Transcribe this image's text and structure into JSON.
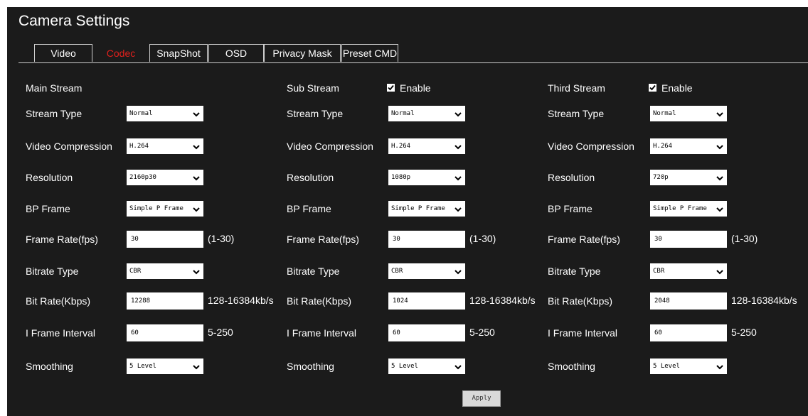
{
  "page_title": "Camera Settings",
  "tabs": [
    {
      "label": "Video",
      "active": false
    },
    {
      "label": "Codec",
      "active": true
    },
    {
      "label": "SnapShot",
      "active": false
    },
    {
      "label": "OSD",
      "active": false
    },
    {
      "label": "Privacy Mask",
      "active": false
    },
    {
      "label": "Preset CMD",
      "active": false
    }
  ],
  "accent_color": "#e0201c",
  "labels": {
    "stream_type": "Stream Type",
    "video_compression": "Video Compression",
    "resolution": "Resolution",
    "bp_frame": "BP Frame",
    "frame_rate": "Frame Rate(fps)",
    "bitrate_type": "Bitrate Type",
    "bit_rate": "Bit Rate(Kbps)",
    "i_frame_interval": "I Frame Interval",
    "smoothing": "Smoothing"
  },
  "hints": {
    "frame_rate": "(1-30)",
    "bit_rate": "128-16384kb/s",
    "i_frame_interval": "5-250"
  },
  "streams": [
    {
      "title": "Main Stream",
      "stream_type": "Normal",
      "video_compression": "H.264",
      "resolution": "2160p30",
      "bp_frame": "Simple P Frame",
      "frame_rate": "30",
      "bitrate_type": "CBR",
      "bit_rate": "12288",
      "i_frame_interval": "60",
      "smoothing": "5 Level"
    },
    {
      "title": "Sub Stream",
      "enable_label": "Enable",
      "enabled": true,
      "stream_type": "Normal",
      "video_compression": "H.264",
      "resolution": "1080p",
      "bp_frame": "Simple P Frame",
      "frame_rate": "30",
      "bitrate_type": "CBR",
      "bit_rate": "1024",
      "i_frame_interval": "60",
      "smoothing": "5 Level"
    },
    {
      "title": "Third Stream",
      "enable_label": "Enable",
      "enabled": true,
      "stream_type": "Normal",
      "video_compression": "H.264",
      "resolution": "720p",
      "bp_frame": "Simple P Frame",
      "frame_rate": "30",
      "bitrate_type": "CBR",
      "bit_rate": "2048",
      "i_frame_interval": "60",
      "smoothing": "5 Level"
    }
  ],
  "apply_label": "Apply"
}
